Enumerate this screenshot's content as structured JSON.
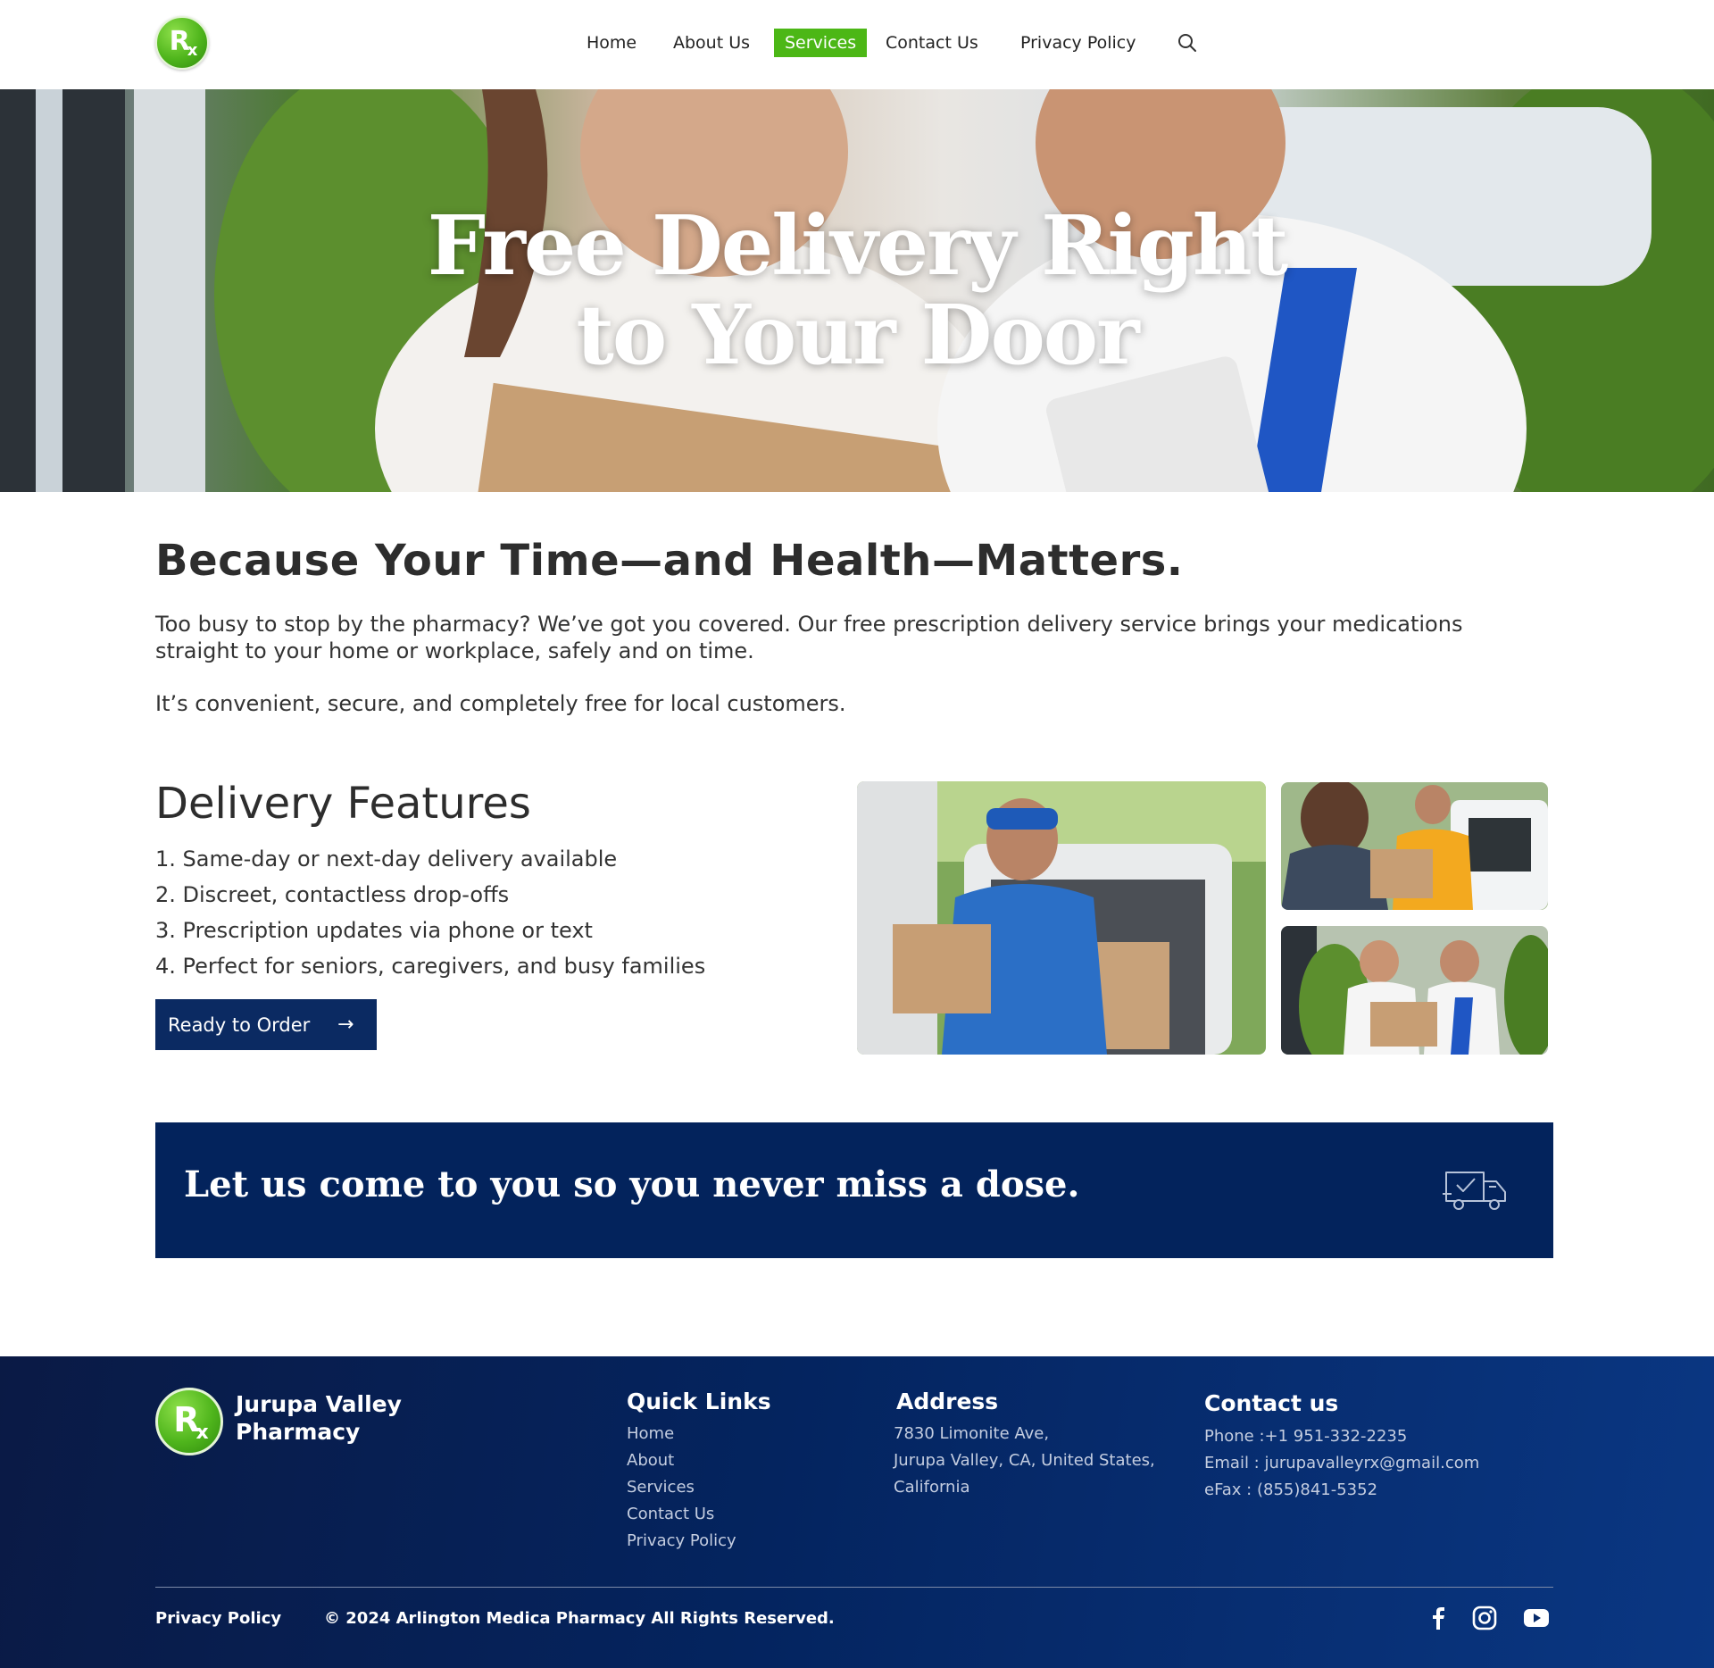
{
  "header": {
    "logo_text": "Rx",
    "nav": [
      {
        "label": "Home",
        "active": false
      },
      {
        "label": "About Us",
        "active": false
      },
      {
        "label": "Services",
        "active": true
      },
      {
        "label": "Contact Us",
        "active": false
      },
      {
        "label": "Privacy Policy",
        "active": false
      }
    ],
    "accent_color": "#4cb716"
  },
  "hero": {
    "title_line1": "Free Delivery Right",
    "title_line2": "to Your Door"
  },
  "intro": {
    "heading": "Because Your Time—and Health—Matters.",
    "p1": "Too busy to stop by the pharmacy? We’ve got you covered. Our free prescription delivery service brings your medications straight to your home or workplace, safely and on time.",
    "p2": "It’s convenient, secure, and completely free for local customers."
  },
  "features": {
    "heading": "Delivery Features",
    "items": [
      "1.  Same-day or next-day delivery available",
      "2. Discreet, contactless drop-offs",
      "3. Prescription updates via phone or text",
      "4. Perfect for seniors, caregivers, and busy families"
    ],
    "button_label": "Ready to Order",
    "button_color": "#0b2a62"
  },
  "banner": {
    "text": "Let us come to you so you never miss a dose.",
    "icon": "delivery-truck-icon",
    "color": "#03235c"
  },
  "footer": {
    "brand": "Jurupa Valley Pharmacy",
    "quick_links_title": "Quick Links",
    "quick_links": [
      "Home",
      "About",
      "Services",
      "Contact Us",
      "Privacy Policy"
    ],
    "address_title": "Address",
    "address_lines": [
      "7830 Limonite Ave,",
      "Jurupa Valley, CA, United States,",
      "California"
    ],
    "contact_title": "Contact us",
    "contact_lines": [
      "Phone :+1 951-332-2235",
      "Email : jurupavalleyrx@gmail.com",
      "eFax : (855)841-5352"
    ],
    "bottom_privacy": "Privacy Policy",
    "copyright": "© 2024 Arlington Medica Pharmacy All Rights Reserved.",
    "social": [
      "facebook-icon",
      "instagram-icon",
      "youtube-icon"
    ]
  }
}
